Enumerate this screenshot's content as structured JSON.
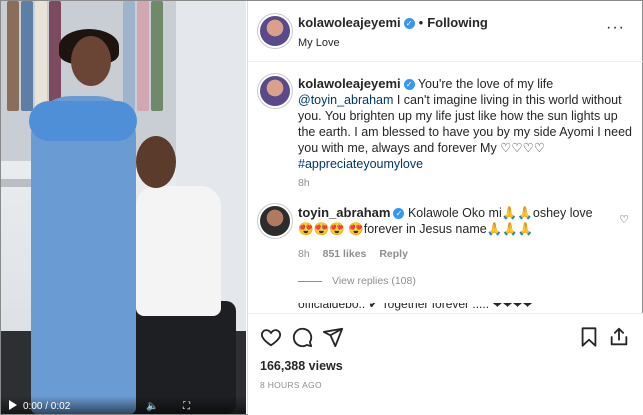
{
  "post": {
    "username": "kolawoleajeyemi",
    "follow_status": "Following",
    "subtitle": "My Love",
    "more_icon": "more-horizontal-icon"
  },
  "caption": {
    "username": "kolawoleajeyemi",
    "text_before": " You're the love of my life ",
    "mention": "@toyin_abraham",
    "text_after": " I can't imagine living in this world without you. You brighten up my life just like how the sun lights up the earth. I am blessed to have you by my side Ayomi I need you with me, always and forever My ♡♡♡♡",
    "hashtag": "#appreciateyoumylove",
    "age": "8h"
  },
  "comment": {
    "username": "toyin_abraham",
    "text": " Kolawole Oko mi🙏🙏oshey love😍😍😍 😍forever in Jesus name🙏🙏🙏",
    "age": "8h",
    "likes": "851 likes",
    "reply_label": "Reply",
    "view_replies": "View replies (108)"
  },
  "peek_comment": {
    "text": "officialdebo.. ✔ Together forever ..... ❤❤❤❤"
  },
  "video": {
    "time": "0:00 / 0:02"
  },
  "stats": {
    "views": "166,388 views",
    "posted": "8 HOURS AGO"
  }
}
